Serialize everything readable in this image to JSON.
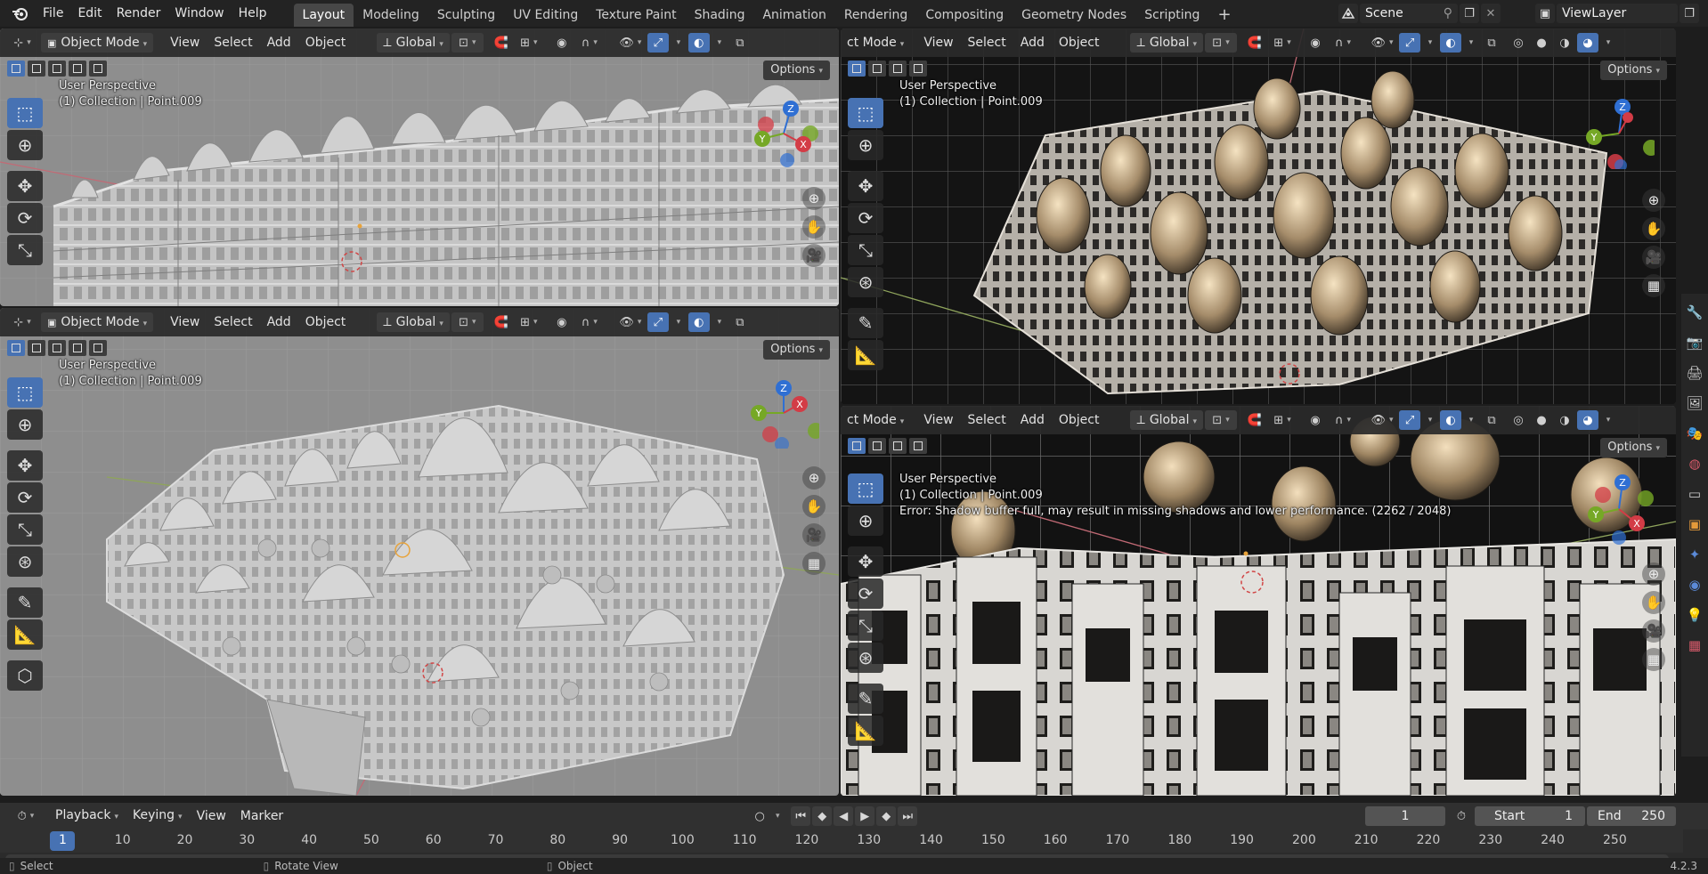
{
  "menu": {
    "items": [
      "File",
      "Edit",
      "Render",
      "Window",
      "Help"
    ]
  },
  "workspaces": {
    "tabs": [
      "Layout",
      "Modeling",
      "Sculpting",
      "UV Editing",
      "Texture Paint",
      "Shading",
      "Animation",
      "Rendering",
      "Compositing",
      "Geometry Nodes",
      "Scripting"
    ],
    "add_label": "+"
  },
  "scene": {
    "name": "Scene",
    "view_layer": "ViewLayer"
  },
  "viewports": [
    {
      "mode": "Object Mode",
      "menus": [
        "View",
        "Select",
        "Add",
        "Object"
      ],
      "orientation": "Global",
      "options": "Options",
      "perspective": "User Perspective",
      "collection": "(1) Collection | Point.009",
      "error": ""
    },
    {
      "mode": "Object Mode",
      "menus": [
        "View",
        "Select",
        "Add",
        "Object"
      ],
      "orientation": "Global",
      "options": "Options",
      "perspective": "User Perspective",
      "collection": "(1) Collection | Point.009",
      "error": ""
    },
    {
      "mode": "ct Mode",
      "menus": [
        "View",
        "Select",
        "Add",
        "Object"
      ],
      "orientation": "Global",
      "options": "Options",
      "perspective": "User Perspective",
      "collection": "(1) Collection | Point.009",
      "error": ""
    },
    {
      "mode": "ct Mode",
      "menus": [
        "View",
        "Select",
        "Add",
        "Object"
      ],
      "orientation": "Global",
      "options": "Options",
      "perspective": "User Perspective",
      "collection": "(1) Collection | Point.009",
      "error": "Error: Shadow buffer full, may result in missing shadows and lower performance. (2262 / 2048)"
    }
  ],
  "gizmo": {
    "x": "X",
    "y": "Y",
    "z": "Z"
  },
  "timeline": {
    "menus": [
      "Playback",
      "Keying",
      "View",
      "Marker"
    ],
    "current_frame": "1",
    "start_label": "Start",
    "start": "1",
    "end_label": "End",
    "end": "250",
    "ticks": [
      "1",
      "10",
      "20",
      "30",
      "40",
      "50",
      "60",
      "70",
      "80",
      "90",
      "100",
      "110",
      "120",
      "130",
      "140",
      "150",
      "160",
      "170",
      "180",
      "190",
      "200",
      "210",
      "220",
      "230",
      "240",
      "250"
    ]
  },
  "statusbar": {
    "items": [
      "Select",
      "Rotate View",
      "Object"
    ],
    "version": "4.2.3"
  },
  "colors": {
    "accent": "#4772b3",
    "viewport_solid": "#8f8f8f",
    "viewport_render": "#141414"
  }
}
